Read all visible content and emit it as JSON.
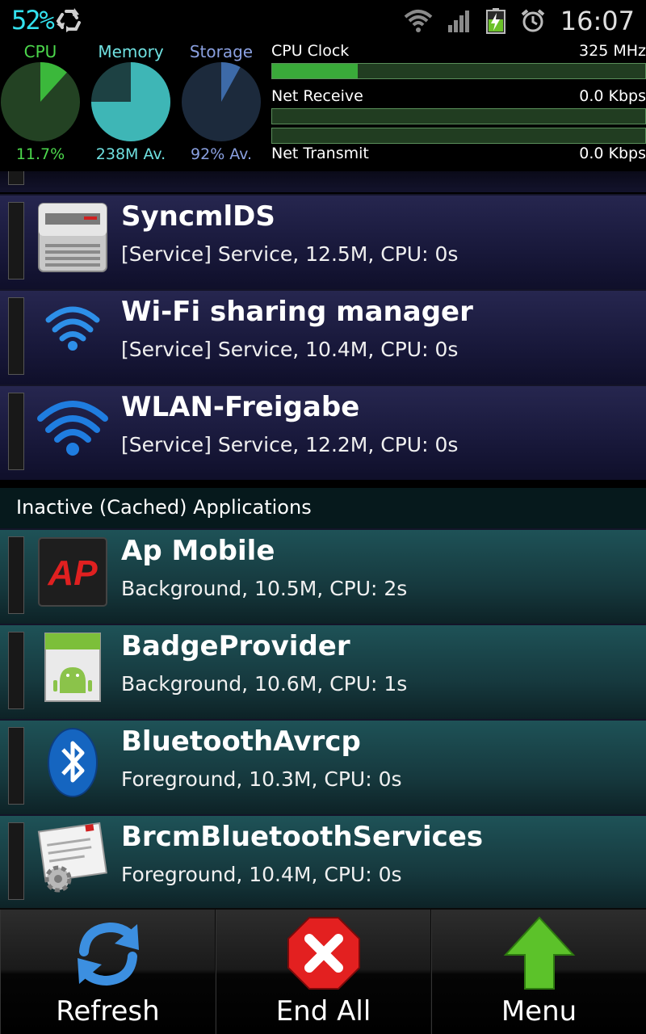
{
  "status_bar": {
    "battery_pct": "52%",
    "time": "16:07",
    "icons": [
      "recycle-icon",
      "wifi-icon",
      "signal-icon",
      "battery-charging-icon",
      "alarm-icon"
    ]
  },
  "monitor": {
    "gauges": [
      {
        "label": "CPU",
        "value": "11.7%",
        "fraction": 0.117,
        "label_color": "#4cd84c",
        "value_color": "#4cd84c"
      },
      {
        "label": "Memory",
        "value": "238M Av.",
        "fraction": 0.75,
        "label_color": "#6fe0e0",
        "value_color": "#6fe0e0"
      },
      {
        "label": "Storage",
        "value": "92% Av.",
        "fraction": 0.08,
        "label_color": "#8aa0e0",
        "value_color": "#8aa0e0"
      }
    ],
    "cpu_clock": {
      "label": "CPU Clock",
      "value": "325 MHz",
      "fraction": 0.23
    },
    "net_receive": {
      "label": "Net Receive",
      "value": "0.0 Kbps",
      "fraction": 0
    },
    "net_transmit": {
      "label": "Net Transmit",
      "value": "0.0 Kbps",
      "fraction": 0
    }
  },
  "service_rows": [
    {
      "name": "SyncmlDS",
      "detail": "[Service] Service, 12.5M, CPU: 0s",
      "icon": "server-icon"
    },
    {
      "name": "Wi-Fi sharing manager",
      "detail": "[Service] Service, 10.4M, CPU: 0s",
      "icon": "wifi-icon"
    },
    {
      "name": "WLAN-Freigabe",
      "detail": "[Service] Service, 12.2M, CPU: 0s",
      "icon": "wifi-icon"
    }
  ],
  "section_header": "Inactive (Cached) Applications",
  "cached_rows": [
    {
      "name": "Ap Mobile",
      "detail": "Background, 10.5M, CPU: 2s",
      "icon": "ap-logo-icon"
    },
    {
      "name": "BadgeProvider",
      "detail": "Background, 10.6M, CPU: 1s",
      "icon": "android-icon"
    },
    {
      "name": "BluetoothAvrcp",
      "detail": "Foreground, 10.3M, CPU: 0s",
      "icon": "bluetooth-icon"
    },
    {
      "name": "BrcmBluetoothServices",
      "detail": "Foreground, 10.4M, CPU: 0s",
      "icon": "settings-window-icon"
    }
  ],
  "buttons": {
    "refresh": "Refresh",
    "end_all": "End All",
    "menu": "Menu"
  },
  "colors": {
    "battery_text": "#33e1ee",
    "bar_fill": "#3aaa3a",
    "service_row": "#22224a",
    "cached_row": "#1a4a4f"
  }
}
